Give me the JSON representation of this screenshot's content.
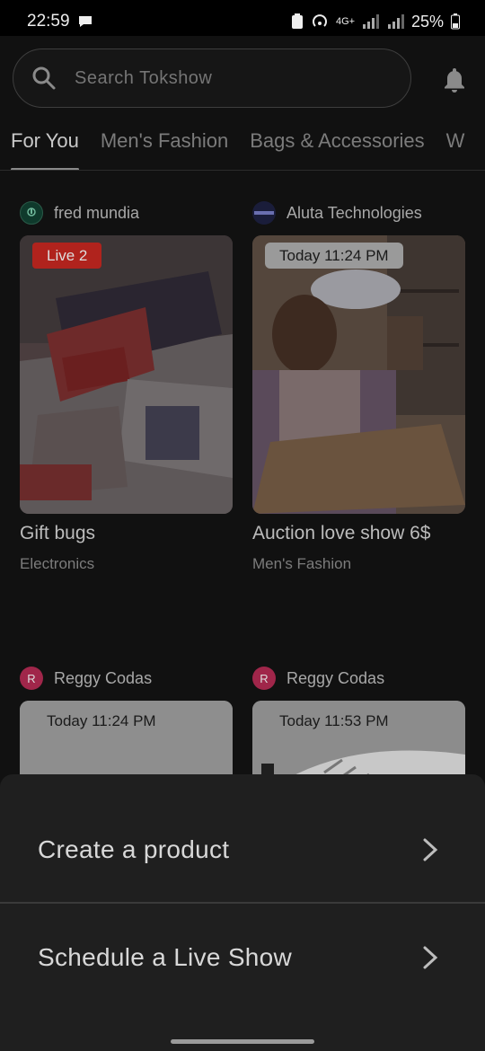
{
  "status_bar": {
    "time": "22:59",
    "network": "4G+",
    "battery": "25%"
  },
  "search": {
    "placeholder": "Search Tokshow"
  },
  "tabs": [
    {
      "label": "For You",
      "active": true
    },
    {
      "label": "Men's Fashion",
      "active": false
    },
    {
      "label": "Bags & Accessories",
      "active": false
    },
    {
      "label": "W",
      "active": false
    }
  ],
  "cards": [
    {
      "seller": "fred mundia",
      "badge": "Live 2",
      "title": "Gift bugs",
      "category": "Electronics"
    },
    {
      "seller": "Aluta Technologies",
      "badge": "Today 11:24 PM",
      "title": "Auction love show 6$",
      "category": "Men's Fashion"
    },
    {
      "seller": "Reggy Codas",
      "avatar_letter": "R",
      "badge": "Today 11:24 PM"
    },
    {
      "seller": "Reggy Codas",
      "avatar_letter": "R",
      "badge": "Today 11:53 PM"
    }
  ],
  "sheet": {
    "items": [
      {
        "label": "Create a product"
      },
      {
        "label": "Schedule a Live Show"
      }
    ]
  },
  "colors": {
    "live_badge": "#b0231d",
    "avatar_pink": "#a0264a",
    "sheet_bg": "#1f1f1f"
  }
}
